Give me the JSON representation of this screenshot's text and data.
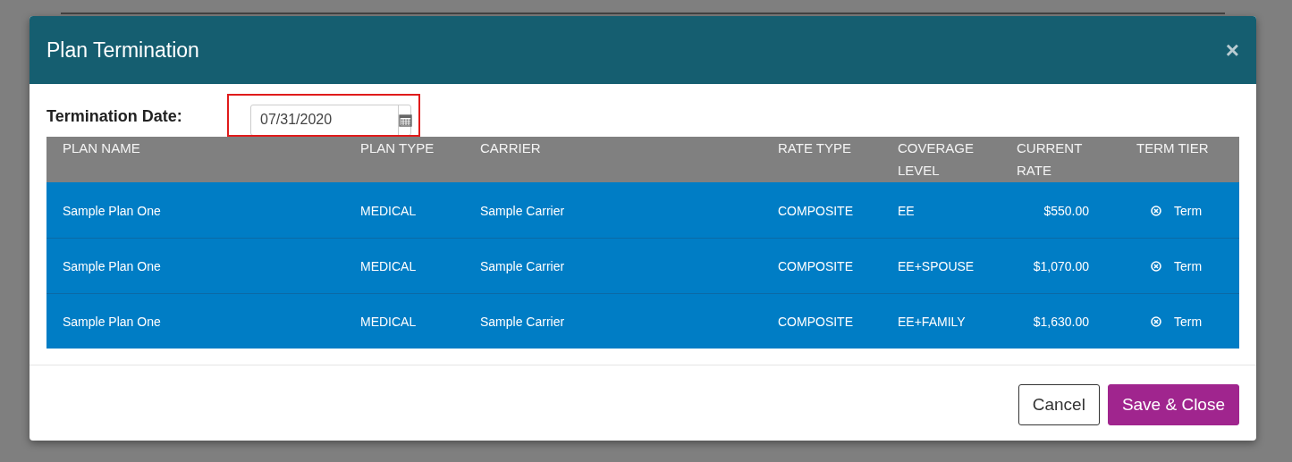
{
  "window": {
    "title": "Plan Termination",
    "close": "×"
  },
  "termination_date": {
    "label": "Termination Date:",
    "value": "07/31/2020",
    "highlighted": true
  },
  "table": {
    "columns": [
      "PLAN NAME",
      "PLAN TYPE",
      "CARRIER",
      "RATE TYPE",
      "COVERAGE LEVEL",
      "CURRENT RATE",
      "TERM TIER"
    ],
    "rows": [
      {
        "plan_name": "Sample Plan One",
        "plan_type": "MEDICAL",
        "carrier": "Sample Carrier",
        "rate_type": "COMPOSITE",
        "coverage_level": "EE",
        "current_rate": "$550.00",
        "term_tier": "Term",
        "selected": true
      },
      {
        "plan_name": "Sample Plan One",
        "plan_type": "MEDICAL",
        "carrier": "Sample Carrier",
        "rate_type": "COMPOSITE",
        "coverage_level": "EE+SPOUSE",
        "current_rate": "$1,070.00",
        "term_tier": "Term",
        "selected": true
      },
      {
        "plan_name": "Sample Plan One",
        "plan_type": "MEDICAL",
        "carrier": "Sample Carrier",
        "rate_type": "COMPOSITE",
        "coverage_level": "EE+FAMILY",
        "current_rate": "$1,630.00",
        "term_tier": "Term",
        "selected": true
      }
    ]
  },
  "buttons": [
    {
      "label": "Cancel",
      "kind": "secondary"
    },
    {
      "label": "Save & Close",
      "kind": "primary"
    }
  ]
}
